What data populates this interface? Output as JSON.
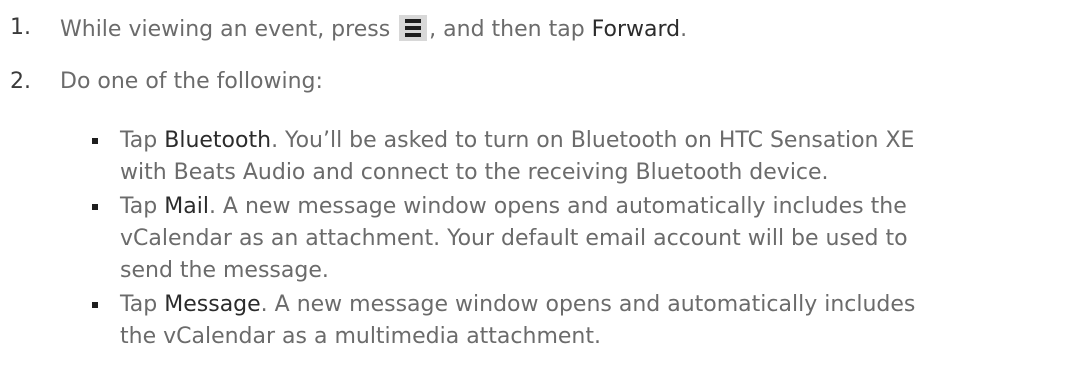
{
  "steps": [
    {
      "num": "1.",
      "text_before": "While viewing an event, press ",
      "icon": "menu-icon",
      "text_middle": ", and then tap ",
      "emphasis": "Forward",
      "text_after": "."
    },
    {
      "num": "2.",
      "text": "Do one of the following:"
    }
  ],
  "options": [
    {
      "prefix": "Tap ",
      "emphasis": "Bluetooth",
      "line1_rest": ". You’ll be asked to turn on Bluetooth on HTC Sensation XE",
      "lines": [
        "with Beats Audio and connect to the receiving Bluetooth device."
      ]
    },
    {
      "prefix": "Tap ",
      "emphasis": "Mail",
      "line1_rest": ". A new message window opens and automatically includes the",
      "lines": [
        "vCalendar as an attachment. Your default email account will be used to",
        "send the message."
      ]
    },
    {
      "prefix": "Tap ",
      "emphasis": "Message",
      "line1_rest": ". A new message window opens and automatically includes",
      "lines": [
        "the vCalendar as a multimedia attachment."
      ]
    }
  ]
}
